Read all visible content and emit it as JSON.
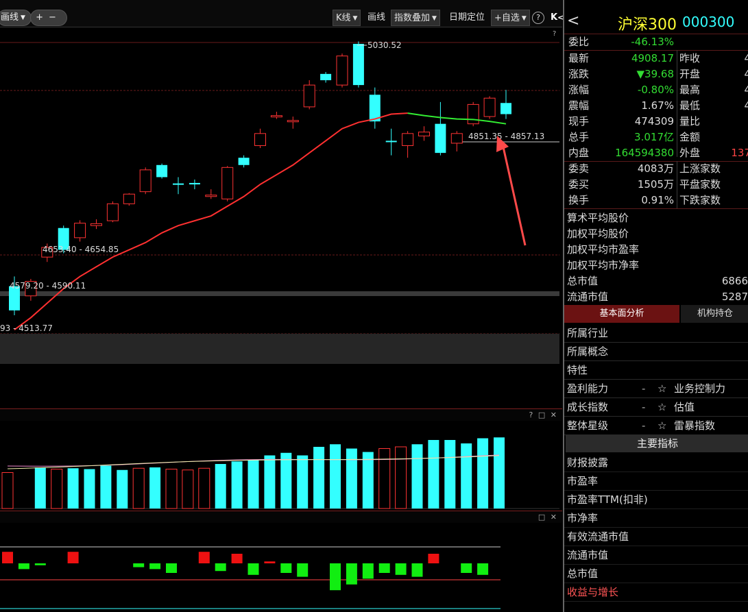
{
  "toolbar": {
    "left_partial": "画线",
    "add": "+",
    "minus": "−",
    "kline": "K线",
    "draw": "画线",
    "index_overlay": "指数叠加",
    "date_locate": "日期定位",
    "watchlist": "+自选",
    "help": "?",
    "collapse": "K"
  },
  "chart": {
    "high_label": "5030.52",
    "range_right": "4851.35 - 4857.13",
    "range_mid": "4653.40 - 4654.85",
    "range_low": "4579.20 - 4590.11",
    "range_bottom": "93 - 4513.77",
    "question": "?"
  },
  "chart_data": {
    "type": "candlestick",
    "candles": [
      {
        "o": 4580,
        "c": 4530,
        "h": 4600,
        "l": 4520,
        "dir": "down"
      },
      {
        "o": 4560,
        "c": 4590,
        "h": 4595,
        "l": 4550,
        "dir": "up"
      },
      {
        "o": 4640,
        "c": 4660,
        "h": 4668,
        "l": 4630,
        "dir": "up"
      },
      {
        "o": 4700,
        "c": 4655,
        "h": 4705,
        "l": 4648,
        "dir": "down"
      },
      {
        "o": 4680,
        "c": 4710,
        "h": 4716,
        "l": 4672,
        "dir": "up"
      },
      {
        "o": 4705,
        "c": 4709,
        "h": 4718,
        "l": 4698,
        "dir": "up"
      },
      {
        "o": 4715,
        "c": 4750,
        "h": 4755,
        "l": 4712,
        "dir": "up"
      },
      {
        "o": 4750,
        "c": 4770,
        "h": 4772,
        "l": 4746,
        "dir": "up"
      },
      {
        "o": 4775,
        "c": 4820,
        "h": 4825,
        "l": 4770,
        "dir": "up"
      },
      {
        "o": 4830,
        "c": 4805,
        "h": 4833,
        "l": 4802,
        "dir": "down"
      },
      {
        "o": 4790,
        "c": 4792,
        "h": 4805,
        "l": 4770,
        "dir": "down"
      },
      {
        "o": 4790,
        "c": 4793,
        "h": 4800,
        "l": 4780,
        "dir": "down"
      },
      {
        "o": 4765,
        "c": 4768,
        "h": 4780,
        "l": 4760,
        "dir": "up"
      },
      {
        "o": 4760,
        "c": 4825,
        "h": 4828,
        "l": 4755,
        "dir": "up"
      },
      {
        "o": 4830,
        "c": 4845,
        "h": 4850,
        "l": 4825,
        "dir": "down"
      },
      {
        "o": 4870,
        "c": 4895,
        "h": 4905,
        "l": 4865,
        "dir": "up"
      },
      {
        "o": 4930,
        "c": 4932,
        "h": 4940,
        "l": 4925,
        "dir": "up"
      },
      {
        "o": 4920,
        "c": 4922,
        "h": 4930,
        "l": 4905,
        "dir": "up"
      },
      {
        "o": 4950,
        "c": 4995,
        "h": 5005,
        "l": 4945,
        "dir": "up"
      },
      {
        "o": 5005,
        "c": 5018,
        "h": 5022,
        "l": 5000,
        "dir": "down"
      },
      {
        "o": 4995,
        "c": 5055,
        "h": 5060,
        "l": 4990,
        "dir": "up"
      },
      {
        "o": 5080,
        "c": 4995,
        "h": 5085,
        "l": 4990,
        "dir": "down"
      },
      {
        "o": 4975,
        "c": 4920,
        "h": 4990,
        "l": 4905,
        "dir": "down"
      },
      {
        "o": 4880,
        "c": 4878,
        "h": 4905,
        "l": 4850,
        "dir": "down"
      },
      {
        "o": 4870,
        "c": 4895,
        "h": 4900,
        "l": 4845,
        "dir": "up"
      },
      {
        "o": 4890,
        "c": 4898,
        "h": 4910,
        "l": 4880,
        "dir": "up"
      },
      {
        "o": 4915,
        "c": 4855,
        "h": 4960,
        "l": 4850,
        "dir": "down"
      },
      {
        "o": 4875,
        "c": 4895,
        "h": 4900,
        "l": 4858,
        "dir": "up"
      },
      {
        "o": 4915,
        "c": 4955,
        "h": 4960,
        "l": 4910,
        "dir": "up"
      },
      {
        "o": 4930,
        "c": 4968,
        "h": 4972,
        "l": 4925,
        "dir": "up"
      },
      {
        "o": 4958,
        "c": 4935,
        "h": 4985,
        "l": 4925,
        "dir": "down"
      }
    ],
    "ma": [
      4490,
      4515,
      4545,
      4575,
      4600,
      4620,
      4640,
      4655,
      4670,
      4690,
      4705,
      4715,
      4725,
      4745,
      4765,
      4790,
      4810,
      4830,
      4855,
      4880,
      4905,
      4918,
      4925,
      4935,
      4937,
      4932,
      4928,
      4925,
      4924,
      4920,
      4915
    ],
    "volume": [
      42,
      0,
      48,
      46,
      47,
      46,
      50,
      45,
      47,
      48,
      46,
      45,
      47,
      52,
      55,
      57,
      62,
      65,
      62,
      72,
      75,
      70,
      66,
      70,
      72,
      75,
      80,
      80,
      76,
      82,
      83
    ],
    "macd": [
      6,
      -3,
      -1,
      0,
      6,
      0,
      0,
      0,
      -2,
      -3,
      -5,
      0,
      6,
      -4,
      5,
      -6,
      1,
      -5,
      -7,
      0,
      -14,
      -11,
      -8,
      -5,
      -6,
      -7,
      5,
      0,
      -5,
      -6,
      0
    ],
    "volume_dir": [
      "down",
      "down",
      "up",
      "down",
      "up",
      "up",
      "up",
      "up",
      "down",
      "up",
      "down",
      "down",
      "down",
      "up",
      "up",
      "up",
      "up",
      "up",
      "up",
      "up",
      "up",
      "up",
      "up",
      "down",
      "down",
      "up",
      "up",
      "up",
      "up",
      "up",
      "up"
    ]
  },
  "panels": {
    "vol_icons": "? □ ✕",
    "macd_icons": "□ ✕"
  },
  "quote": {
    "back": "<",
    "name": "沪深300",
    "code": "000300",
    "webi_label": "委比",
    "webi_value": "-46.13%",
    "latest_label": "最新",
    "latest_value": "4908.17",
    "prev_close_label": "昨收",
    "prev_close_value": "4",
    "change_label": "涨跌",
    "change_value": "▼39.68",
    "open_label": "开盘",
    "open_value": "4",
    "pct_label": "涨幅",
    "pct_value": "-0.80%",
    "high_label": "最高",
    "high_value": "4",
    "amp_label": "震幅",
    "amp_value": "1.67%",
    "low_label": "最低",
    "low_value": "4",
    "cur_hand_label": "现手",
    "cur_hand_value": "474309",
    "vol_ratio_label": "量比",
    "vol_ratio_value": "",
    "total_hand_label": "总手",
    "total_hand_value": "3.017亿",
    "amount_label": "金额",
    "amount_value": "",
    "inner_label": "内盘",
    "inner_value": "164594380",
    "outer_label": "外盘",
    "outer_value": "137",
    "ask_label": "委卖",
    "ask_value": "4083万",
    "up_count_label": "上涨家数",
    "bid_label": "委买",
    "bid_value": "1505万",
    "flat_count_label": "平盘家数",
    "turnover_label": "换手",
    "turnover_value": "0.91%",
    "down_count_label": "下跌家数"
  },
  "stats": {
    "arith_avg": "算术平均股价",
    "weighted_avg": "加权平均股价",
    "weighted_pe": "加权平均市盈率",
    "weighted_pb": "加权平均市净率",
    "total_mv_label": "总市值",
    "total_mv_value": "6866",
    "float_mv_label": "流通市值",
    "float_mv_value": "5287"
  },
  "tabs": {
    "fundamentals": "基本面分析",
    "institution": "机构持仓"
  },
  "fundamentals": {
    "industry": "所属行业",
    "concept": "所属概念",
    "features": "特性",
    "profit_label": "盈利能力",
    "profit_dash": "-",
    "profit_star": "☆",
    "profit_right": "业务控制力",
    "growth_label": "成长指数",
    "growth_dash": "-",
    "growth_star": "☆",
    "growth_right": "估值",
    "overall_label": "整体星级",
    "overall_dash": "-",
    "overall_star": "☆",
    "overall_right": "雷暴指数"
  },
  "key_indicators": {
    "header": "主要指标",
    "items": [
      "财报披露",
      "市盈率",
      "市盈率TTM(扣非)",
      "市净率",
      "有效流通市值",
      "流通市值",
      "总市值",
      "收益与增长"
    ]
  },
  "colors": {
    "up": "#ff3333",
    "down": "#33ffff",
    "ma_up": "#ff3030",
    "ma_flat": "#33ee33",
    "green_text": "#33dd33",
    "red_text": "#ff4444",
    "arrow": "#ff4a4a"
  }
}
